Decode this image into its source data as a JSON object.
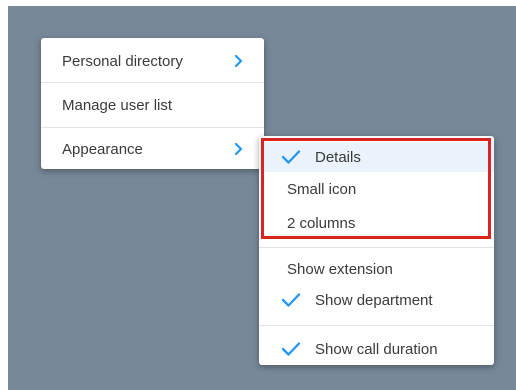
{
  "menu": {
    "items": [
      {
        "label": "Personal directory",
        "has_submenu": true
      },
      {
        "label": "Manage user list",
        "has_submenu": false
      },
      {
        "label": "Appearance",
        "has_submenu": true
      }
    ]
  },
  "submenu": {
    "view_options": [
      {
        "label": "Details",
        "checked": true
      },
      {
        "label": "Small icon",
        "checked": false
      },
      {
        "label": "2 columns",
        "checked": false
      }
    ],
    "display_options": [
      {
        "label": "Show extension",
        "checked": false
      },
      {
        "label": "Show department",
        "checked": true
      }
    ],
    "extra_options": [
      {
        "label": "Show call duration",
        "checked": true
      }
    ]
  },
  "colors": {
    "backdrop": "#778899",
    "accent": "#2196f3",
    "highlight": "#dd2222"
  }
}
